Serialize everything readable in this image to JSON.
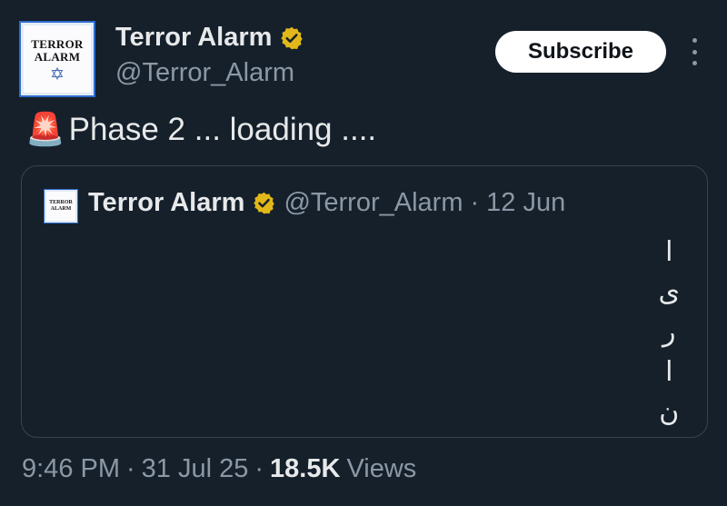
{
  "author": {
    "display_name": "Terror Alarm",
    "handle": "@Terror_Alarm",
    "avatar_lines": [
      "TERROR",
      "ALARM"
    ],
    "verified_icon": "verified-badge-gold"
  },
  "actions": {
    "subscribe_label": "Subscribe",
    "more_icon": "vertical-ellipsis-icon"
  },
  "tweet": {
    "emoji": "🚨",
    "text": "Phase 2 ... loading ...."
  },
  "quoted_tweet": {
    "display_name": "Terror Alarm",
    "handle": "@Terror_Alarm",
    "separator": "·",
    "date": "12 Jun",
    "vertical_letters": [
      "ا",
      "ی",
      "ر",
      "ا",
      "ن"
    ]
  },
  "footer": {
    "time": "9:46 PM",
    "separator": "·",
    "date": "31 Jul 25",
    "views_count": "18.5K",
    "views_label": "Views"
  },
  "colors": {
    "background": "#15202b",
    "text_primary": "#e7e9ea",
    "text_secondary": "#8b98a5",
    "verified_gold": "#e2b719",
    "border": "#38444d"
  }
}
